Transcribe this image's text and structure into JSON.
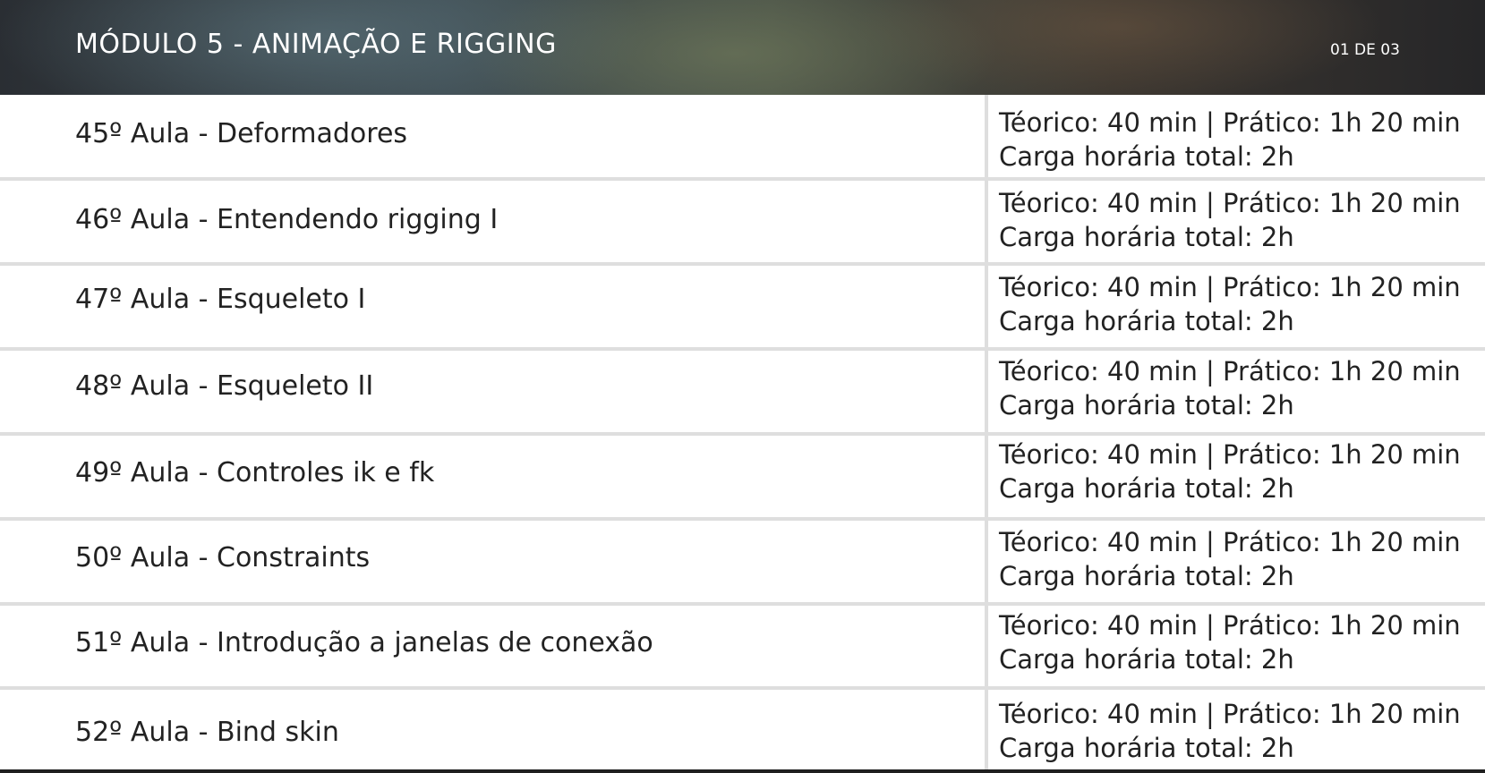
{
  "header": {
    "module_title": "MÓDULO 5 - ANIMAÇÃO E RIGGING",
    "page_counter": "01 DE 03"
  },
  "lessons": [
    {
      "title": "45º Aula - Deformadores",
      "hours_line1": "Téorico: 40 min | Prático: 1h 20 min",
      "hours_line2": "Carga horária total: 2h"
    },
    {
      "title": "46º Aula - Entendendo rigging I",
      "hours_line1": "Téorico: 40 min | Prático: 1h 20 min",
      "hours_line2": "Carga horária total: 2h"
    },
    {
      "title": "47º Aula - Esqueleto I",
      "hours_line1": "Téorico: 40 min | Prático: 1h 20 min",
      "hours_line2": "Carga horária total: 2h"
    },
    {
      "title": "48º Aula - Esqueleto II",
      "hours_line1": "Téorico: 40 min | Prático: 1h 20 min",
      "hours_line2": "Carga horária total: 2h"
    },
    {
      "title": "49º Aula - Controles ik e fk",
      "hours_line1": "Téorico: 40 min | Prático: 1h 20 min",
      "hours_line2": "Carga horária total: 2h"
    },
    {
      "title": "50º Aula - Constraints",
      "hours_line1": "Téorico: 40 min | Prático: 1h 20 min",
      "hours_line2": "Carga horária total: 2h"
    },
    {
      "title": "51º Aula - Introdução a janelas de conexão",
      "hours_line1": "Téorico: 40 min | Prático: 1h 20 min",
      "hours_line2": "Carga horária total: 2h"
    },
    {
      "title": "52º Aula - Bind skin",
      "hours_line1": "Téorico: 40 min | Prático: 1h 20 min",
      "hours_line2": "Carga horária total: 2h"
    }
  ]
}
